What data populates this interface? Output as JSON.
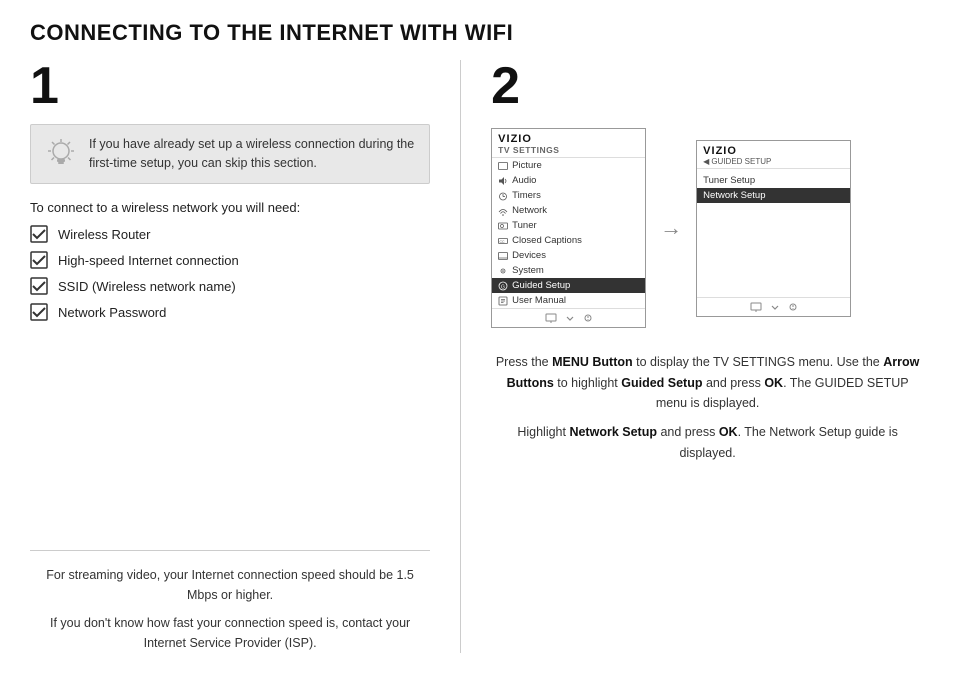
{
  "title": "CONNECTING TO THE INTERNET WITH WIFI",
  "step1": {
    "number": "1",
    "tip": {
      "text": "If you have already set up a wireless connection during the first-time setup, you can skip this section."
    },
    "need_label": "To connect to a wireless network you will need:",
    "checklist": [
      "Wireless Router",
      "High-speed Internet connection",
      "SSID (Wireless network name)",
      "Network Password"
    ],
    "bottom_note_lines": [
      "For streaming video, your Internet connection speed should be 1.5 Mbps or higher.",
      "If you don't know how fast your connection speed is, contact your Internet Service Provider (ISP)."
    ]
  },
  "step2": {
    "number": "2",
    "screen1": {
      "brand": "VIZIO",
      "subtitle": "TV SETTINGS",
      "items": [
        {
          "label": "Picture",
          "icon": "picture"
        },
        {
          "label": "Audio",
          "icon": "audio"
        },
        {
          "label": "Timers",
          "icon": "timers"
        },
        {
          "label": "Network",
          "icon": "network"
        },
        {
          "label": "Tuner",
          "icon": "tuner"
        },
        {
          "label": "Closed Captions",
          "icon": "cc"
        },
        {
          "label": "Devices",
          "icon": "devices"
        },
        {
          "label": "System",
          "icon": "system"
        },
        {
          "label": "Guided Setup",
          "icon": "guided",
          "highlighted": true
        },
        {
          "label": "User Manual",
          "icon": "manual"
        }
      ]
    },
    "screen2": {
      "brand": "VIZIO",
      "back_label": "GUIDED SETUP",
      "items": [
        {
          "label": "Tuner Setup"
        },
        {
          "label": "Network Setup",
          "highlighted": true
        }
      ]
    },
    "description_parts": [
      {
        "text": "Press the ",
        "bold": false
      },
      {
        "text": "MENU Button",
        "bold": true
      },
      {
        "text": " to display the TV SETTINGS menu. Use the ",
        "bold": false
      },
      {
        "text": "Arrow Buttons",
        "bold": true
      },
      {
        "text": " to highlight ",
        "bold": false
      },
      {
        "text": "Guided Setup",
        "bold": true
      },
      {
        "text": " and press ",
        "bold": false
      },
      {
        "text": "OK",
        "bold": true
      },
      {
        "text": ". The GUIDED SETUP menu is displayed.",
        "bold": false
      }
    ],
    "description2_parts": [
      {
        "text": "Highlight ",
        "bold": false
      },
      {
        "text": "Network Setup",
        "bold": true
      },
      {
        "text": " and press ",
        "bold": false
      },
      {
        "text": "OK",
        "bold": true
      },
      {
        "text": ". The Network Setup guide is displayed.",
        "bold": false
      }
    ]
  }
}
